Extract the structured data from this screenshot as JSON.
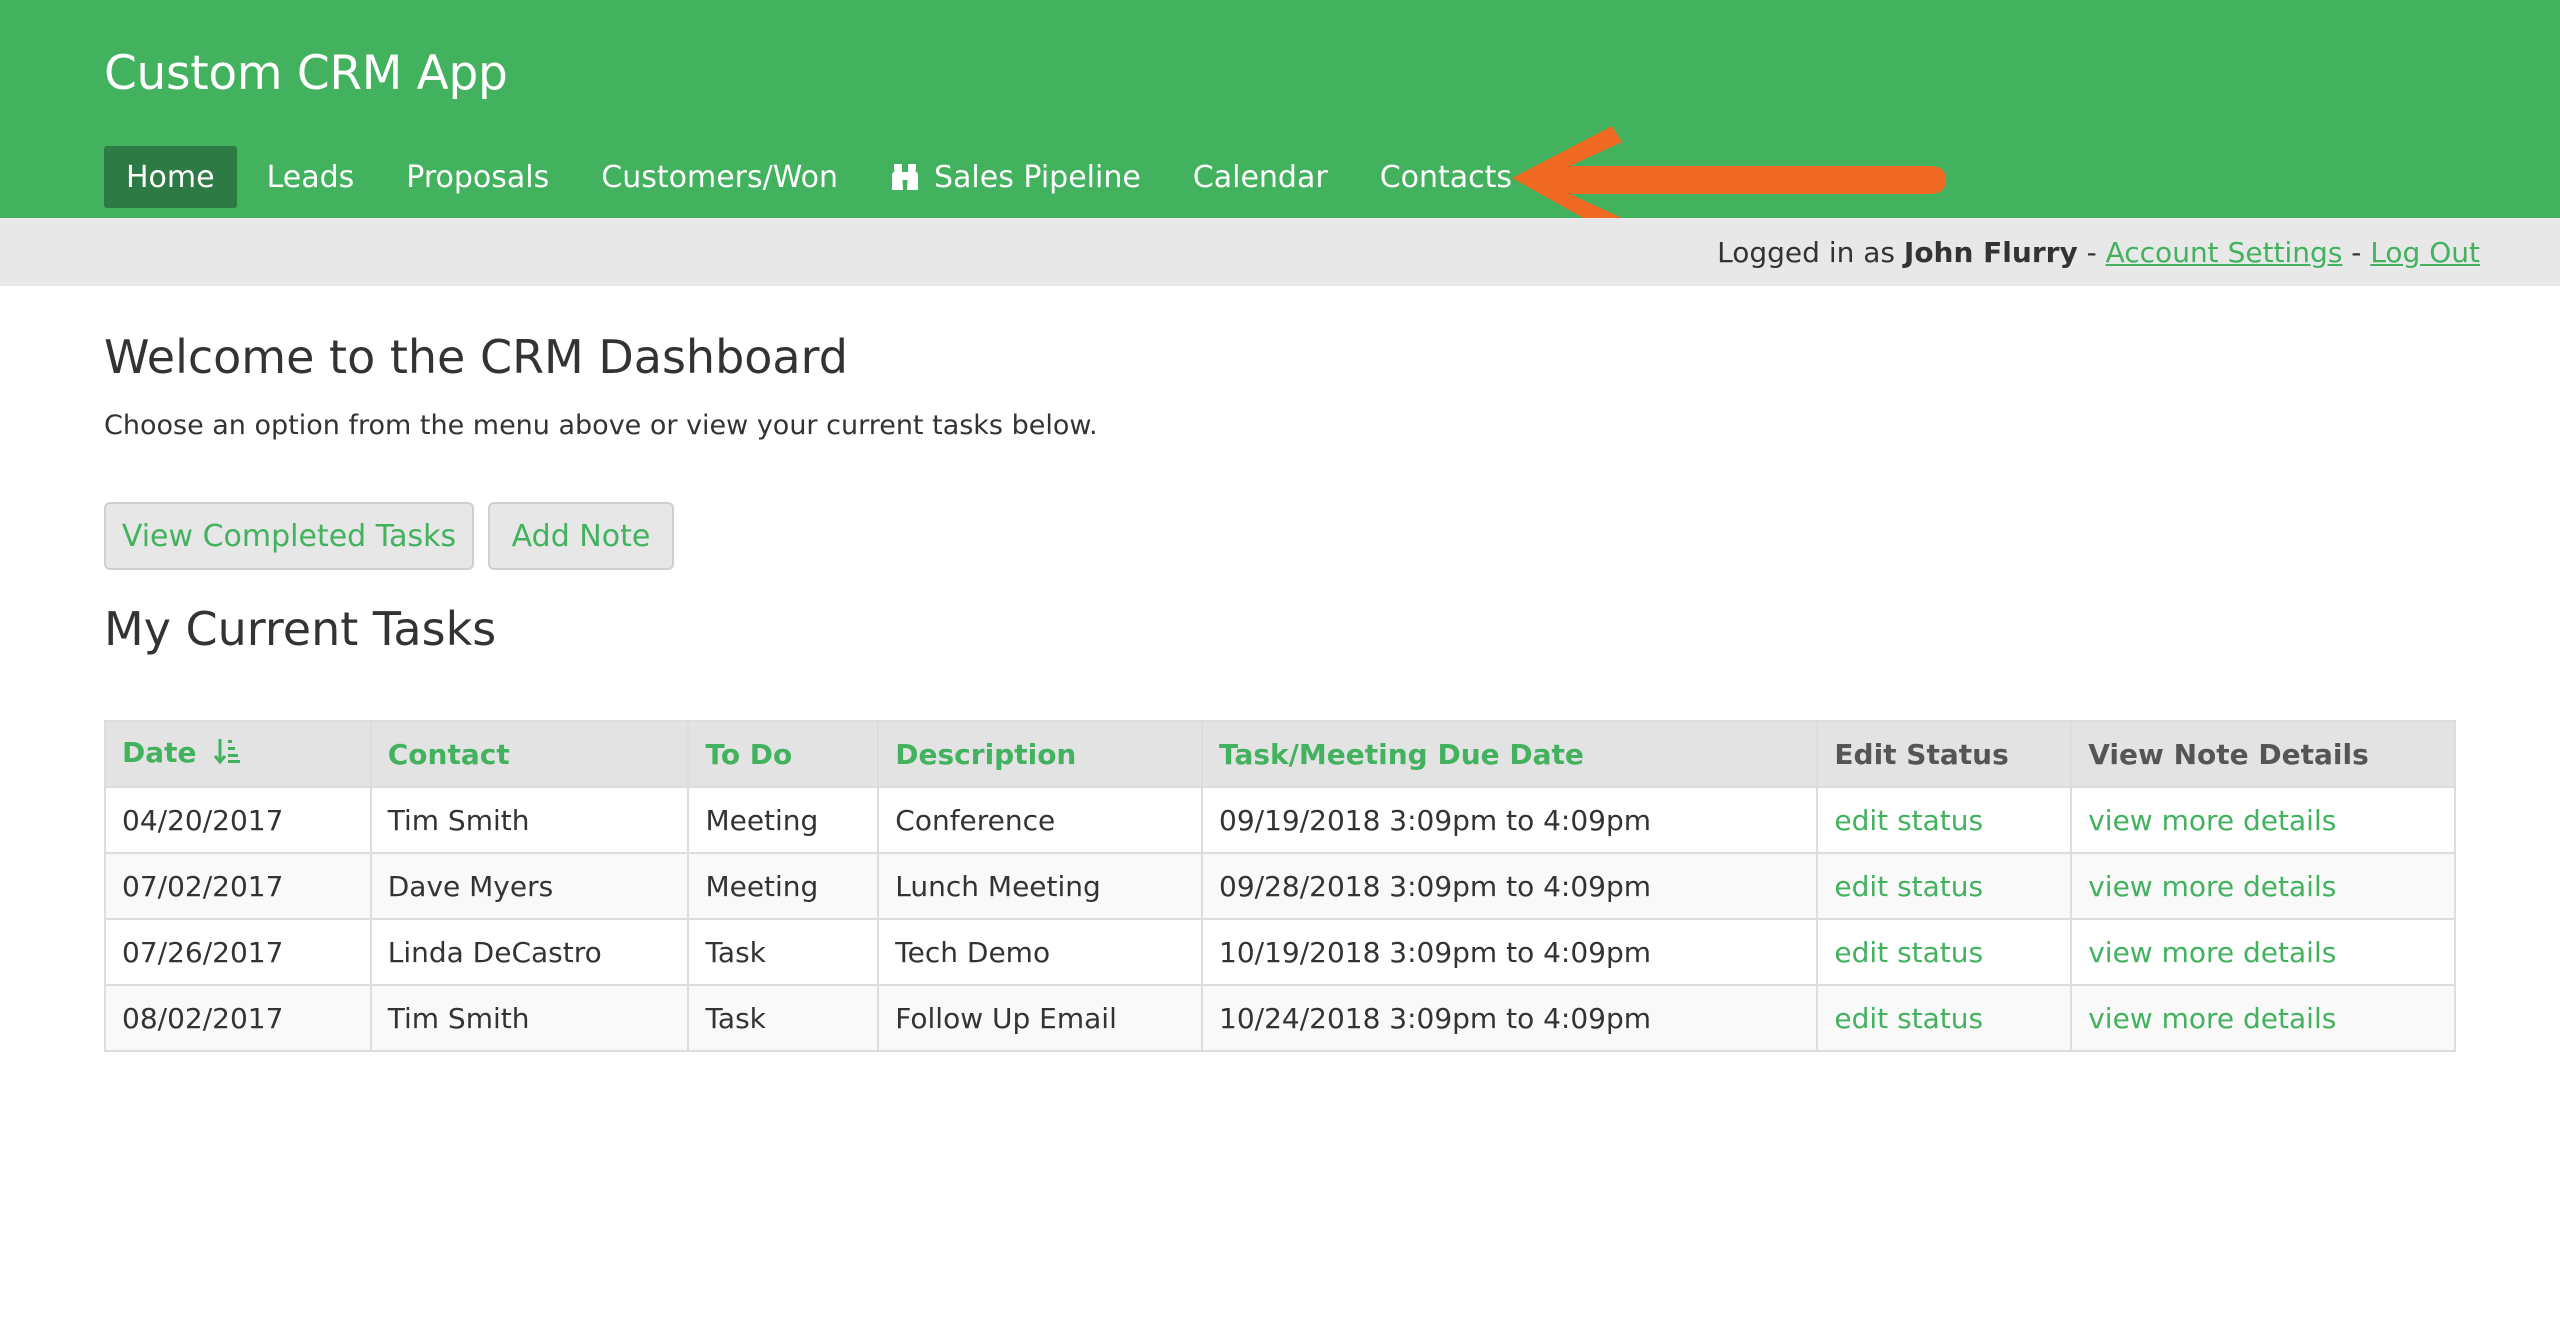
{
  "app": {
    "title": "Custom CRM App"
  },
  "nav": {
    "items": [
      {
        "label": "Home",
        "active": true
      },
      {
        "label": "Leads"
      },
      {
        "label": "Proposals"
      },
      {
        "label": "Customers/Won"
      },
      {
        "label": "Sales Pipeline",
        "icon": "binoculars-icon"
      },
      {
        "label": "Calendar"
      },
      {
        "label": "Contacts"
      }
    ]
  },
  "annotation": {
    "icon": "arrow-left-icon",
    "color": "#f06a23"
  },
  "userbar": {
    "prefix": "Logged in as ",
    "user": "John Flurry",
    "sep1": " - ",
    "account_settings": "Account Settings",
    "sep2": " - ",
    "logout": "Log Out"
  },
  "main": {
    "welcome": "Welcome to the CRM Dashboard",
    "subtitle": "Choose an option from the menu above or view your current tasks below.",
    "buttons": {
      "completed": "View Completed Tasks",
      "add_note": "Add Note"
    },
    "tasks_title": "My Current Tasks"
  },
  "table": {
    "headers": [
      "Date",
      "Contact",
      "To Do",
      "Description",
      "Task/Meeting Due Date",
      "Edit Status",
      "View Note Details"
    ],
    "rows": [
      {
        "date": "04/20/2017",
        "contact": "Tim Smith",
        "todo": "Meeting",
        "description": "Conference",
        "due": "09/19/2018 3:09pm to 4:09pm",
        "edit": "edit status",
        "view": "view more details"
      },
      {
        "date": "07/02/2017",
        "contact": "Dave Myers",
        "todo": "Meeting",
        "description": "Lunch Meeting",
        "due": "09/28/2018 3:09pm to 4:09pm",
        "edit": "edit status",
        "view": "view more details"
      },
      {
        "date": "07/26/2017",
        "contact": "Linda DeCastro",
        "todo": "Task",
        "description": "Tech Demo",
        "due": "10/19/2018 3:09pm to 4:09pm",
        "edit": "edit status",
        "view": "view more details"
      },
      {
        "date": "08/02/2017",
        "contact": "Tim Smith",
        "todo": "Task",
        "description": "Follow Up Email",
        "due": "10/24/2018 3:09pm to 4:09pm",
        "edit": "edit status",
        "view": "view more details"
      }
    ]
  },
  "colors": {
    "brand": "#42b25f",
    "active_nav": "#2e7a45",
    "userbar_bg": "#e8e8e8"
  }
}
